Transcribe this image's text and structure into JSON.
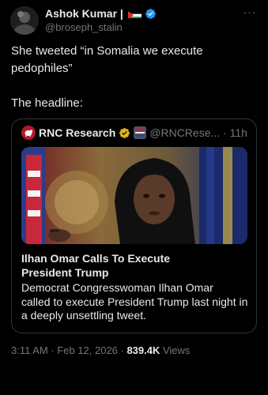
{
  "author": {
    "name": "Ashok Kumar |",
    "handle": "@broseph_stalin",
    "flag_icon": "palestine-flag-icon",
    "verified_color": "#1d9bf0"
  },
  "tweet": {
    "line1": "She tweeted “in Somalia we execute",
    "line2": "pedophiles”",
    "line3": "The headline:"
  },
  "quote": {
    "account_name": "RNC Research",
    "handle_time": "@RNCRese... · 11h",
    "title_line1": "Ilhan Omar Calls To Execute",
    "title_line2": "President Trump",
    "desc_line1": "Democrat Congresswoman Ilhan Omar",
    "desc_line2": "called to execute President Trump last night in",
    "desc_line3": "a deeply unsettling tweet.",
    "verified_color": "#e2b719"
  },
  "meta": {
    "timestamp": "3:11 AM · Feb 12, 2026 · ",
    "views_count": "839.4K",
    "views_label": " Views"
  },
  "more_icon": "···"
}
